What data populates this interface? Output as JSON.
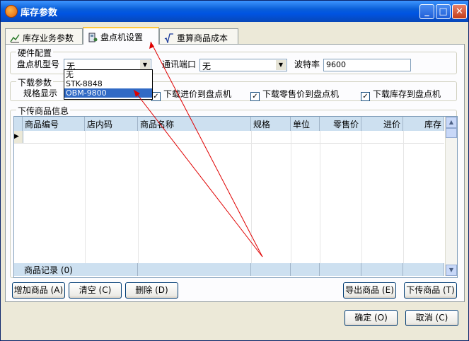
{
  "window": {
    "title": "库存参数"
  },
  "title_buttons": {
    "minimize": "_",
    "maximize": "□",
    "close": "✕"
  },
  "tabs": [
    {
      "label": "库存业务参数",
      "icon": "chart-icon"
    },
    {
      "label": "盘点机设置",
      "icon": "scanner-icon",
      "active": true
    },
    {
      "label": "重算商品成本",
      "icon": "sqrt-icon"
    }
  ],
  "hardware": {
    "group_label": "硬件配置",
    "model_label": "盘点机型号",
    "model_value": "无",
    "port_label": "通讯端口",
    "port_value": "无",
    "baud_label": "波特率",
    "baud_value": "9600"
  },
  "model_dropdown": {
    "options": [
      "无",
      "STK-8848",
      "OBM-9800"
    ],
    "highlighted": "OBM-9800"
  },
  "download": {
    "group_label": "下载参数",
    "spec_label": "规格显示",
    "checks": [
      {
        "label": "下载进价到盘点机",
        "checked": true
      },
      {
        "label": "下载零售价到盘点机",
        "checked": true
      },
      {
        "label": "下载库存到盘点机",
        "checked": true
      }
    ]
  },
  "upload": {
    "group_label": "下传商品信息",
    "columns": [
      "商品编号",
      "店内码",
      "商品名称",
      "规格",
      "单位",
      "零售价",
      "进价",
      "库存"
    ],
    "footer": "商品记录 (0)"
  },
  "actions": {
    "add": "增加商品 (A)",
    "clear": "清空 (C)",
    "delete": "删除 (D)",
    "export": "导出商品 (E)",
    "download": "下传商品 (T)"
  },
  "dialog": {
    "ok": "确定 (O)",
    "cancel": "取消 (C)"
  },
  "colors": {
    "title_bar": "#0054e3",
    "selection": "#316ac5",
    "annotation_arrow": "#e00000"
  }
}
